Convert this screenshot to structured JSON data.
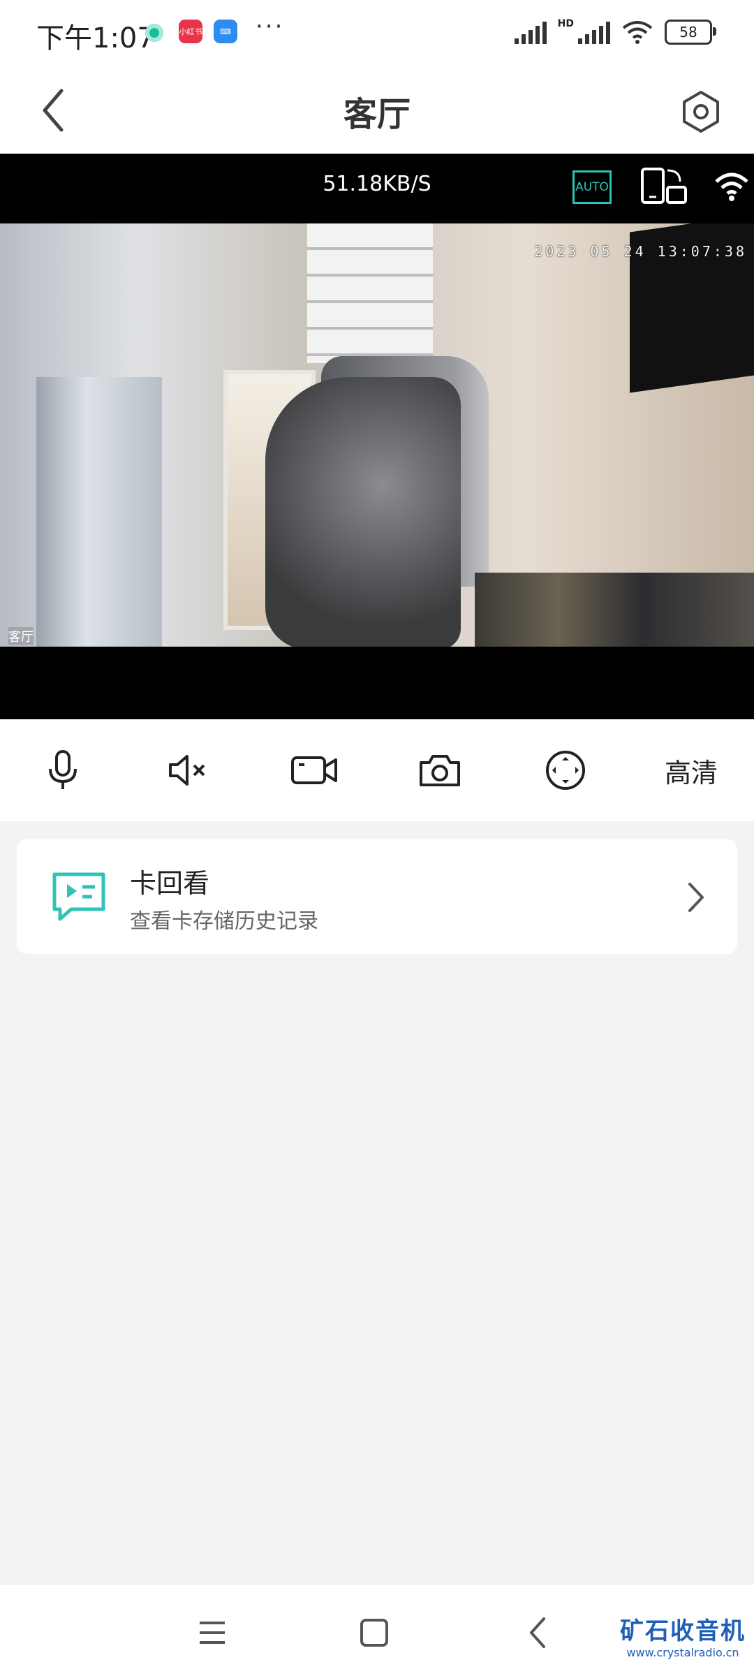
{
  "status_bar": {
    "time": "下午1:07",
    "app_icon_1": "小红书",
    "more": "···",
    "network": "HD",
    "battery": "58"
  },
  "header": {
    "title": "客厅"
  },
  "player": {
    "speed": "51.18KB/S",
    "quality_badge": "AUTO",
    "osd_datetime": "2023 05 24 13:07:38",
    "osd_name": "客厅"
  },
  "controls": {
    "quality_label": "高清"
  },
  "playback_card": {
    "title": "卡回看",
    "subtitle": "查看卡存储历史记录"
  },
  "watermark": {
    "brand": "矿石收音机",
    "url": "www.crystalradio.cn"
  },
  "colors": {
    "accent": "#2fc3b5",
    "background": "#f3f3f3",
    "video_bg": "#000000"
  }
}
